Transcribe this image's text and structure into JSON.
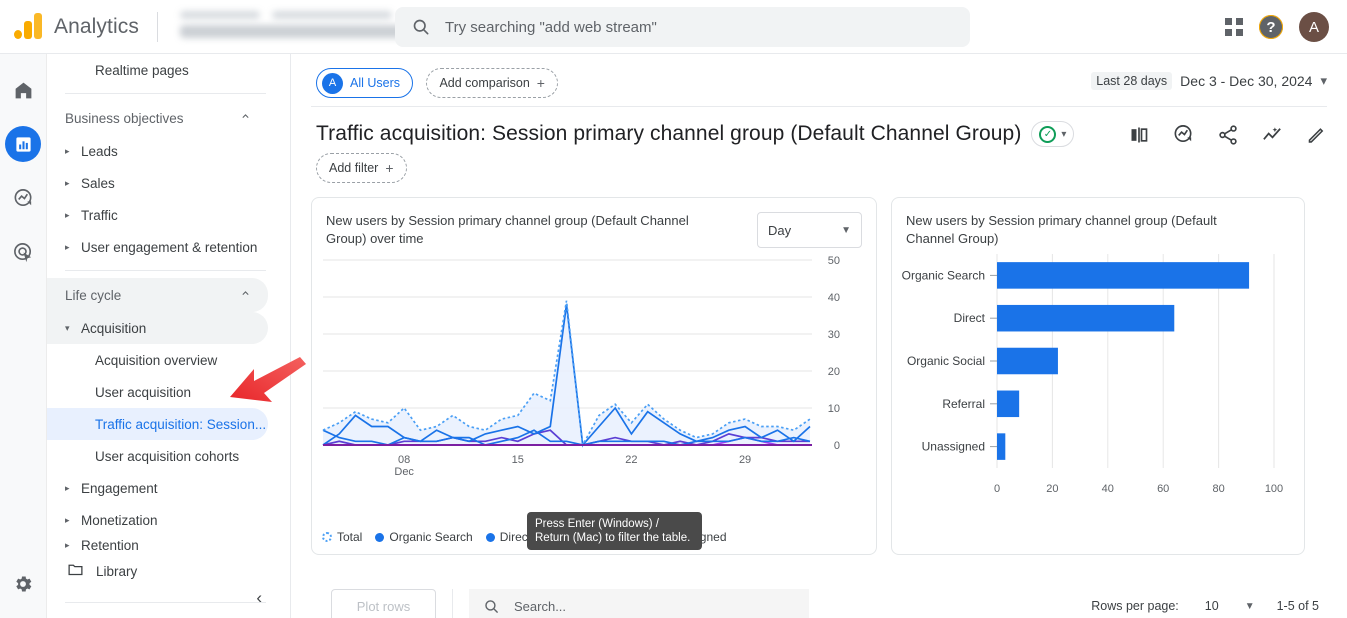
{
  "topbar": {
    "brand": "Analytics",
    "search_placeholder": "Try searching \"add web stream\"",
    "search_icon": "search-icon",
    "apps_icon": "apps-grid-icon",
    "help_icon": "help-icon",
    "help_glyph": "?",
    "avatar_initial": "A"
  },
  "rail": {
    "items": [
      {
        "name": "home-icon",
        "label": "Home"
      },
      {
        "name": "reports-icon",
        "label": "Reports",
        "active": true
      },
      {
        "name": "explore-icon",
        "label": "Explore"
      },
      {
        "name": "advertising-icon",
        "label": "Advertising"
      }
    ],
    "settings": {
      "name": "gear-icon",
      "label": "Admin"
    }
  },
  "sidebar": {
    "top_item": "Realtime pages",
    "business_objectives": {
      "label": "Business objectives",
      "items": [
        "Leads",
        "Sales",
        "Traffic",
        "User engagement & retention"
      ]
    },
    "life_cycle": {
      "label": "Life cycle",
      "acquisition": "Acquisition",
      "sub_items": [
        "Acquisition overview",
        "User acquisition",
        "Traffic acquisition: Session...",
        "User acquisition cohorts"
      ],
      "selected_sub": "Traffic acquisition: Session...",
      "after_items": [
        "Engagement",
        "Monetization",
        "Retention"
      ]
    },
    "library": "Library",
    "collapse_glyph": "‹"
  },
  "toolbar": {
    "all_users_chip": "All Users",
    "all_users_initial": "A",
    "add_comparison": "Add comparison",
    "plus_glyph": "+",
    "date_badge": "Last 28 days",
    "date_range": "Dec 3 - Dec 30, 2024",
    "caret_glyph": "▾"
  },
  "page": {
    "title": "Traffic acquisition: Session primary channel group (Default Channel Group)",
    "badge_glyph": "✓",
    "add_filter": "Add filter",
    "actions": [
      {
        "name": "compare-icon",
        "label": "Compare"
      },
      {
        "name": "insights-icon",
        "label": "Insights"
      },
      {
        "name": "share-icon",
        "label": "Share"
      },
      {
        "name": "trends-icon",
        "label": "Trends"
      },
      {
        "name": "edit-pencil-icon",
        "label": "Edit"
      }
    ]
  },
  "line_card": {
    "title": "New users by Session primary channel group (Default Channel Group) over time",
    "granularity": "Day",
    "legend": [
      {
        "label": "Total",
        "color": "#4a9ff5",
        "style": "dotted"
      },
      {
        "label": "Organic Search",
        "color": "#1a73e8",
        "style": "solid"
      },
      {
        "label": "Direct",
        "color": "#1a73e8",
        "style": "solid"
      },
      {
        "label": "Organic Social",
        "color": "#5b3fd4",
        "style": "solid"
      },
      {
        "label": "Unassigned",
        "color": "#a142f4",
        "style": "solid"
      }
    ],
    "tooltip": "Press Enter (Windows) / Return (Mac) to filter the table."
  },
  "bar_card": {
    "title": "New users by Session primary channel group (Default Channel Group)"
  },
  "bottom": {
    "plot_rows": "Plot rows",
    "search_placeholder": "Search...",
    "search_icon": "search-icon",
    "rows_per_page_label": "Rows per page:",
    "rows_per_page_value": "10",
    "range": "1-5 of 5"
  },
  "chart_data": [
    {
      "type": "line",
      "id": "new-users-over-time",
      "title": "New users by Session primary channel group (Default Channel Group) over time",
      "xlabel": "Dec",
      "ylabel": "",
      "ylim": [
        0,
        50
      ],
      "yticks": [
        0,
        10,
        20,
        30,
        40,
        50
      ],
      "xticks": [
        "08\nDec",
        "15",
        "22",
        "29"
      ],
      "xtick_positions": [
        5,
        12,
        19,
        26
      ],
      "grid": true,
      "legend_position": "bottom",
      "x": [
        1,
        2,
        3,
        4,
        5,
        6,
        7,
        8,
        9,
        10,
        11,
        12,
        13,
        14,
        15,
        16,
        17,
        18,
        19,
        20,
        21,
        22,
        23,
        24,
        25,
        26,
        27,
        28,
        29,
        30
      ],
      "series": [
        {
          "name": "Total",
          "color": "#4a9ff5",
          "style": "dotted",
          "area": true,
          "values": [
            4,
            6,
            9,
            7,
            6,
            10,
            4,
            5,
            8,
            5,
            4,
            7,
            8,
            14,
            12,
            39,
            0,
            8,
            11,
            6,
            11,
            7,
            4,
            2,
            3,
            6,
            7,
            5,
            5,
            4,
            7
          ]
        },
        {
          "name": "Organic Search",
          "color": "#1a73e8",
          "style": "solid",
          "values": [
            0,
            3,
            8,
            5,
            5,
            2,
            1,
            4,
            2,
            1,
            3,
            4,
            5,
            3,
            5,
            38,
            0,
            5,
            10,
            3,
            9,
            6,
            3,
            1,
            2,
            4,
            5,
            2,
            4,
            1,
            5
          ]
        },
        {
          "name": "Direct",
          "color": "#1a73e8",
          "style": "solid",
          "values": [
            4,
            2,
            1,
            1,
            0,
            2,
            1,
            1,
            2,
            2,
            0,
            1,
            2,
            4,
            1,
            1,
            0,
            1,
            1,
            1,
            1,
            1,
            0,
            1,
            1,
            1,
            2,
            1,
            1,
            2,
            1
          ]
        },
        {
          "name": "Organic Social",
          "color": "#5b3fd4",
          "style": "solid",
          "values": [
            0,
            1,
            0,
            0,
            0,
            1,
            1,
            1,
            2,
            1,
            1,
            2,
            1,
            3,
            4,
            0,
            0,
            1,
            2,
            1,
            1,
            0,
            1,
            0,
            1,
            3,
            2,
            2,
            1,
            1,
            1
          ]
        },
        {
          "name": "Unassigned",
          "color": "#a142f4",
          "style": "solid",
          "values": [
            0,
            0,
            0,
            0,
            0,
            0,
            0,
            0,
            0,
            0,
            0,
            0,
            0,
            0,
            0,
            0,
            0,
            0,
            0,
            0,
            0,
            0,
            0,
            0,
            0,
            1,
            2,
            1,
            0,
            0,
            0
          ]
        }
      ]
    },
    {
      "type": "bar",
      "id": "new-users-by-channel",
      "orientation": "horizontal",
      "title": "New users by Session primary channel group (Default Channel Group)",
      "categories": [
        "Organic Search",
        "Direct",
        "Organic Social",
        "Referral",
        "Unassigned"
      ],
      "values": [
        91,
        64,
        22,
        8,
        3
      ],
      "xlabel": "",
      "ylabel": "",
      "xlim": [
        0,
        100
      ],
      "xticks": [
        0,
        20,
        40,
        60,
        80,
        100
      ],
      "bar_color": "#1a73e8",
      "grid": true
    }
  ]
}
